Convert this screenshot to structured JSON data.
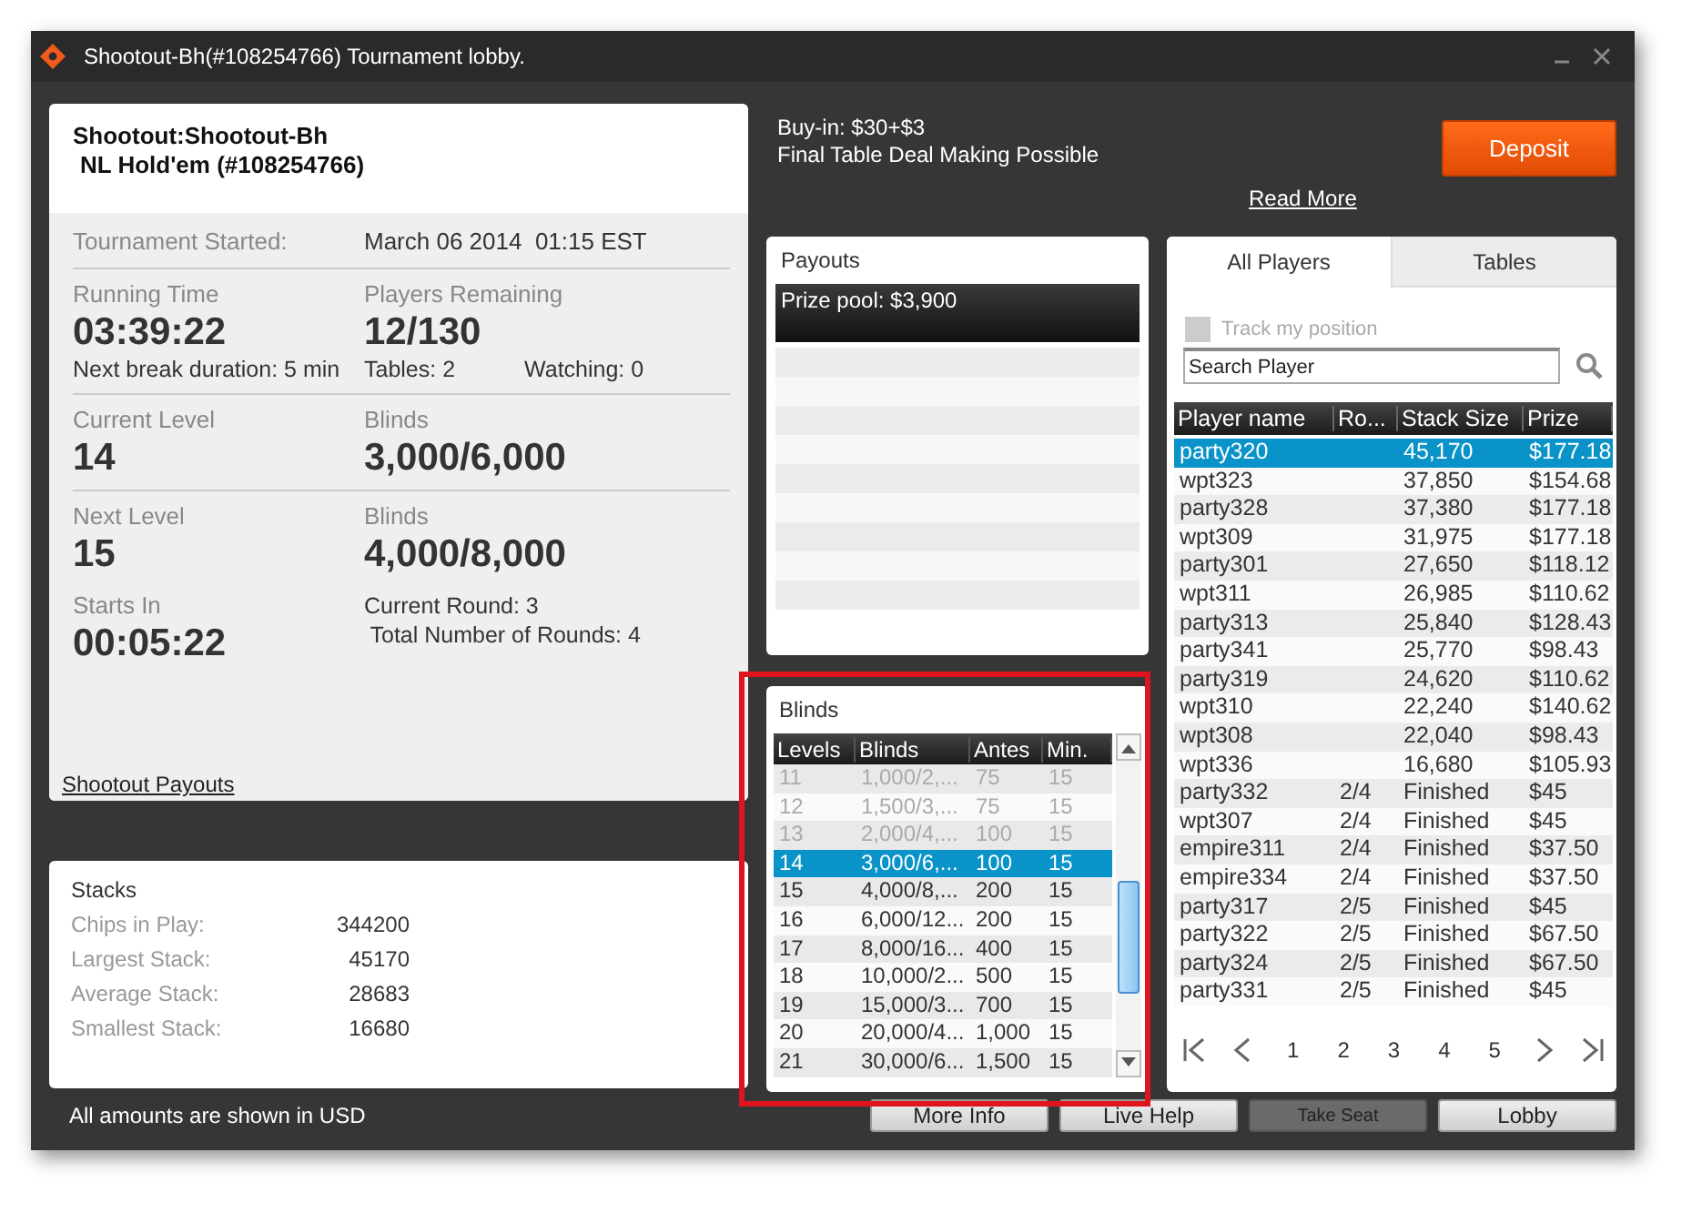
{
  "window": {
    "title": "Shootout-Bh(#108254766) Tournament lobby."
  },
  "tournament": {
    "title": "Shootout:Shootout-Bh",
    "subtitle": "NL Hold'em (#108254766)",
    "started_label": "Tournament Started:",
    "started_value": "March 06 2014  01:15 EST",
    "sections": [
      {
        "rows": [
          {
            "cells": [
              {
                "label": "Running Time",
                "value": "03:39:22",
                "notes": [
                  "Next break duration: 5 min"
                ]
              },
              {
                "label": "Players Remaining",
                "value": "12/130",
                "notes": [
                  "Tables: 2",
                  "Watching: 0"
                ]
              }
            ]
          }
        ]
      },
      {
        "rows": [
          {
            "cells": [
              {
                "label": "Current Level",
                "value": "14"
              },
              {
                "label": "Blinds",
                "value": "3,000/6,000"
              }
            ]
          }
        ]
      },
      {
        "rows": [
          {
            "cells": [
              {
                "label": "Next Level",
                "value": "15"
              },
              {
                "label": "Blinds",
                "value": "4,000/8,000"
              }
            ]
          },
          {
            "cells": [
              {
                "label": "Starts In",
                "value": "00:05:22"
              },
              {
                "notes": [
                  "Current Round: 3",
                  " Total Number of Rounds: 4"
                ]
              }
            ]
          }
        ]
      }
    ],
    "link": "Shootout Payouts"
  },
  "stacks": {
    "title": "Stacks",
    "rows": [
      {
        "label": "Chips in Play:",
        "value": "344200"
      },
      {
        "label": "Largest Stack:",
        "value": "45170"
      },
      {
        "label": "Average Stack:",
        "value": "28683"
      },
      {
        "label": "Smallest Stack:",
        "value": "16680"
      }
    ]
  },
  "footer_note": "All amounts are shown in USD",
  "header": {
    "lines": [
      "Buy-in: $30+$3",
      "Final Table Deal Making Possible"
    ],
    "deposit": "Deposit",
    "read_more": "Read More"
  },
  "payouts": {
    "title": "Payouts",
    "prize_pool": "Prize pool: $3,900"
  },
  "blinds": {
    "title": "Blinds",
    "highlighted": true,
    "columns": [
      "Levels",
      "Blinds",
      "Antes",
      "Min."
    ],
    "rows": [
      {
        "cells": [
          "11",
          "1,000/2,...",
          "75",
          "15"
        ],
        "completed": true,
        "selected": false
      },
      {
        "cells": [
          "12",
          "1,500/3,...",
          "75",
          "15"
        ],
        "completed": true,
        "selected": false
      },
      {
        "cells": [
          "13",
          "2,000/4,...",
          "100",
          "15"
        ],
        "completed": true,
        "selected": false
      },
      {
        "cells": [
          "14",
          "3,000/6,...",
          "100",
          "15"
        ],
        "completed": false,
        "selected": true
      },
      {
        "cells": [
          "15",
          "4,000/8,...",
          "200",
          "15"
        ],
        "completed": false,
        "selected": false
      },
      {
        "cells": [
          "16",
          "6,000/12...",
          "200",
          "15"
        ],
        "completed": false,
        "selected": false
      },
      {
        "cells": [
          "17",
          "8,000/16...",
          "400",
          "15"
        ],
        "completed": false,
        "selected": false
      },
      {
        "cells": [
          "18",
          "10,000/2...",
          "500",
          "15"
        ],
        "completed": false,
        "selected": false
      },
      {
        "cells": [
          "19",
          "15,000/3...",
          "700",
          "15"
        ],
        "completed": false,
        "selected": false
      },
      {
        "cells": [
          "20",
          "20,000/4...",
          "1,000",
          "15"
        ],
        "completed": false,
        "selected": false
      },
      {
        "cells": [
          "21",
          "30,000/6...",
          "1,500",
          "15"
        ],
        "completed": false,
        "selected": false
      }
    ]
  },
  "players": {
    "tabs": [
      {
        "label": "All Players",
        "selected": true
      },
      {
        "label": "Tables",
        "selected": false
      }
    ],
    "track": {
      "label": "Track my position",
      "checked": false,
      "disabled": true
    },
    "search": {
      "placeholder": "Search Player"
    },
    "columns": [
      "Player name",
      "Ro...",
      "Stack Size",
      "Prize"
    ],
    "rows": [
      {
        "cells": [
          "party320",
          "",
          "45,170",
          "$177.18"
        ],
        "selected": true
      },
      {
        "cells": [
          "wpt323",
          "",
          "37,850",
          "$154.68"
        ],
        "selected": false
      },
      {
        "cells": [
          "party328",
          "",
          "37,380",
          "$177.18"
        ],
        "selected": false
      },
      {
        "cells": [
          "wpt309",
          "",
          "31,975",
          "$177.18"
        ],
        "selected": false
      },
      {
        "cells": [
          "party301",
          "",
          "27,650",
          "$118.12"
        ],
        "selected": false
      },
      {
        "cells": [
          "wpt311",
          "",
          "26,985",
          "$110.62"
        ],
        "selected": false
      },
      {
        "cells": [
          "party313",
          "",
          "25,840",
          "$128.43"
        ],
        "selected": false
      },
      {
        "cells": [
          "party341",
          "",
          "25,770",
          "$98.43"
        ],
        "selected": false
      },
      {
        "cells": [
          "party319",
          "",
          "24,620",
          "$110.62"
        ],
        "selected": false
      },
      {
        "cells": [
          "wpt310",
          "",
          "22,240",
          "$140.62"
        ],
        "selected": false
      },
      {
        "cells": [
          "wpt308",
          "",
          "22,040",
          "$98.43"
        ],
        "selected": false
      },
      {
        "cells": [
          "wpt336",
          "",
          "16,680",
          "$105.93"
        ],
        "selected": false
      },
      {
        "cells": [
          "party332",
          "2/4",
          "Finished",
          "$45"
        ],
        "selected": false
      },
      {
        "cells": [
          "wpt307",
          "2/4",
          "Finished",
          "$45"
        ],
        "selected": false
      },
      {
        "cells": [
          "empire311",
          "2/4",
          "Finished",
          "$37.50"
        ],
        "selected": false
      },
      {
        "cells": [
          "empire334",
          "2/4",
          "Finished",
          "$37.50"
        ],
        "selected": false
      },
      {
        "cells": [
          "party317",
          "2/5",
          "Finished",
          "$45"
        ],
        "selected": false
      },
      {
        "cells": [
          "party322",
          "2/5",
          "Finished",
          "$67.50"
        ],
        "selected": false
      },
      {
        "cells": [
          "party324",
          "2/5",
          "Finished",
          "$67.50"
        ],
        "selected": false
      },
      {
        "cells": [
          "party331",
          "2/5",
          "Finished",
          "$45"
        ],
        "selected": false
      }
    ],
    "pages": [
      "1",
      "2",
      "3",
      "4",
      "5"
    ]
  },
  "buttons": [
    {
      "label": "More Info",
      "disabled": false
    },
    {
      "label": "Live Help",
      "disabled": false
    },
    {
      "label": "Take Seat",
      "disabled": true
    },
    {
      "label": "Lobby",
      "disabled": false
    }
  ]
}
